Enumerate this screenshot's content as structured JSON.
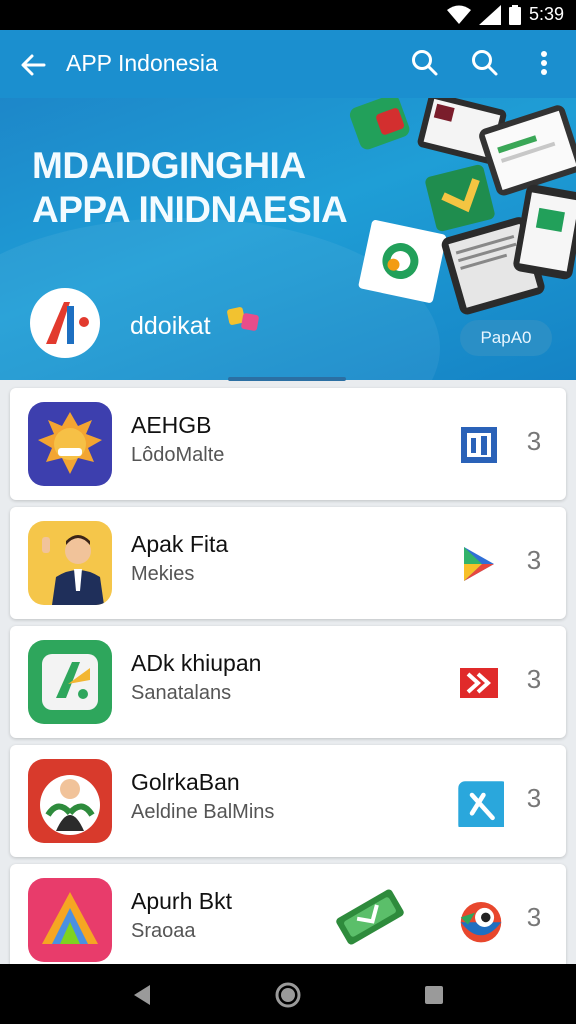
{
  "status_bar": {
    "time": "5:39"
  },
  "app_bar": {
    "title": "APP Indonesia",
    "back_icon": "back-arrow-icon",
    "search_icon": "search-icon",
    "menu_icon": "more-vert-icon"
  },
  "banner": {
    "headline_line1": "MDAIDGINGHIA",
    "headline_line2": "APPA INIDNAESIA",
    "brand": "ddoikat",
    "button": "PapA0"
  },
  "apps": [
    {
      "name": "AEHGB",
      "subtitle": "LôdoMalte",
      "more": "3"
    },
    {
      "name": "Apak Fita",
      "subtitle": "Mekies",
      "more": "3"
    },
    {
      "name": "ADk khiupan",
      "subtitle": "Sanatalans",
      "more": "3"
    },
    {
      "name": "GolrkaBan",
      "subtitle": "Aeldine BalMins",
      "more": "3"
    },
    {
      "name": "Apurh Bkt",
      "subtitle": "Sraoaa",
      "more": "3"
    }
  ],
  "colors": {
    "primary": "#1b8fcf",
    "banner": "#1f9ed6"
  }
}
